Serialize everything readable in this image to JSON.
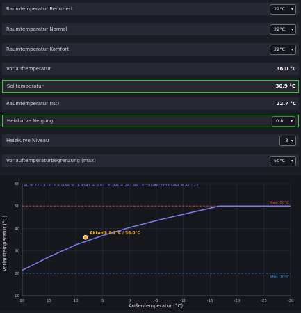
{
  "settings": [
    {
      "label": "Raumtemperatur Reduziert",
      "type": "select",
      "value": "22°C",
      "highlight": false
    },
    {
      "label": "Raumtemperatur Normal",
      "type": "select",
      "value": "22°C",
      "highlight": false
    },
    {
      "label": "Raumtemperatur Komfort",
      "type": "select",
      "value": "22°C",
      "highlight": false
    },
    {
      "label": "Vorlauftemperatur",
      "type": "value",
      "value": "36.0 °C",
      "highlight": false
    },
    {
      "label": "Solltemperatur",
      "type": "value",
      "value": "30.9 °C",
      "highlight": true
    },
    {
      "label": "Raumtemperatur (Ist)",
      "type": "value",
      "value": "22.7 °C",
      "highlight": false
    },
    {
      "label": "Heizkurve Neigung",
      "type": "select",
      "value": "0.8",
      "highlight": true
    },
    {
      "label": "Heizkurve Niveau",
      "type": "select",
      "value": "-3",
      "highlight": false
    },
    {
      "label": "Vorlauftemperaturbegrenzung (max)",
      "type": "select",
      "value": "50°C",
      "highlight": false
    }
  ],
  "colors": {
    "highlight_border": "#2bd12b",
    "curve": "#7b7ff0",
    "max_line": "#e04848",
    "min_line": "#3d8be0",
    "current_point": "#f0a830"
  },
  "chart_data": {
    "type": "line",
    "formula": "VL = 22 - 3 - 0.8 × DAR × (1.4347 + 0.021×DAR + 247.9×10⁻⁶×DAR²) mit DAR = AT - 22",
    "xlabel": "Außentemperatur (°C)",
    "ylabel": "Vorlauftemperatur (°C)",
    "xlim": [
      20,
      -30
    ],
    "ylim": [
      10,
      60
    ],
    "x_ticks": [
      "20",
      "15",
      "10",
      "5",
      "0",
      "-5",
      "-10",
      "-15",
      "-20",
      "-25",
      "-30"
    ],
    "y_ticks": [
      "10",
      "20",
      "30",
      "40",
      "50",
      "60"
    ],
    "series": [
      {
        "x": [
          20,
          15,
          10,
          5,
          0,
          -5,
          -10,
          -15,
          -16.8,
          -20,
          -25,
          -30
        ],
        "y": [
          21.3,
          27.3,
          32.7,
          36.8,
          40.4,
          43.5,
          46.3,
          49.0,
          50,
          50,
          50,
          50
        ]
      }
    ],
    "max_line": {
      "y": 50,
      "label": "Max: 50°C"
    },
    "min_line": {
      "y": 20,
      "label": "Min: 20°C"
    },
    "current_point": {
      "x": 8.2,
      "y": 36.0,
      "label": "Aktuell: 8.2°C / 36.0°C"
    },
    "grid": true
  }
}
